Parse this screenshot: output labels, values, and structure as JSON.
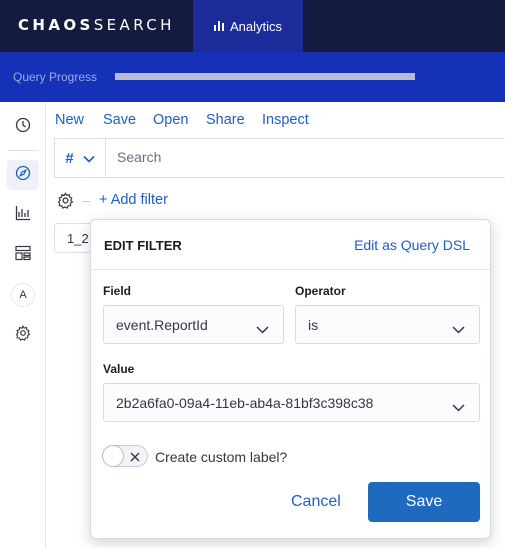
{
  "header": {
    "logo_bold": "CHAOS",
    "logo_light": "SEARCH",
    "active_tab": {
      "label": "Analytics",
      "icon": "bar-chart-icon"
    }
  },
  "progress": {
    "label": "Query Progress",
    "percent": 100
  },
  "sidebar": {
    "items": [
      {
        "icon": "clock-icon",
        "active": false
      },
      {
        "icon": "compass-icon",
        "active": true
      },
      {
        "icon": "visualize-icon",
        "active": false
      },
      {
        "icon": "dashboard-icon",
        "active": false
      },
      {
        "icon": "letter-a-icon",
        "label": "A",
        "active": false
      },
      {
        "icon": "gear-icon",
        "active": false
      }
    ]
  },
  "menu": {
    "new": "New",
    "save": "Save",
    "open": "Open",
    "share": "Share",
    "inspect": "Inspect"
  },
  "query": {
    "language_symbol": "#",
    "placeholder": "Search"
  },
  "filters": {
    "add_filter": "+ Add filter",
    "chip_text": "1_2"
  },
  "edit_filter": {
    "title": "EDIT FILTER",
    "edit_dsl_link": "Edit as Query DSL",
    "field_label": "Field",
    "field_value": "event.ReportId",
    "operator_label": "Operator",
    "operator_value": "is",
    "value_label": "Value",
    "value_value": "2b2a6fa0-09a4-11eb-ab4a-81bf3c398c38",
    "custom_label_text": "Create custom label?",
    "custom_label_enabled": false,
    "cancel": "Cancel",
    "save": "Save"
  },
  "colors": {
    "topbar": "#141b3f",
    "active_tab": "#1b2c9a",
    "progress_band": "#1431b8",
    "link": "#1e5fc2",
    "primary_button": "#1e6abf"
  }
}
